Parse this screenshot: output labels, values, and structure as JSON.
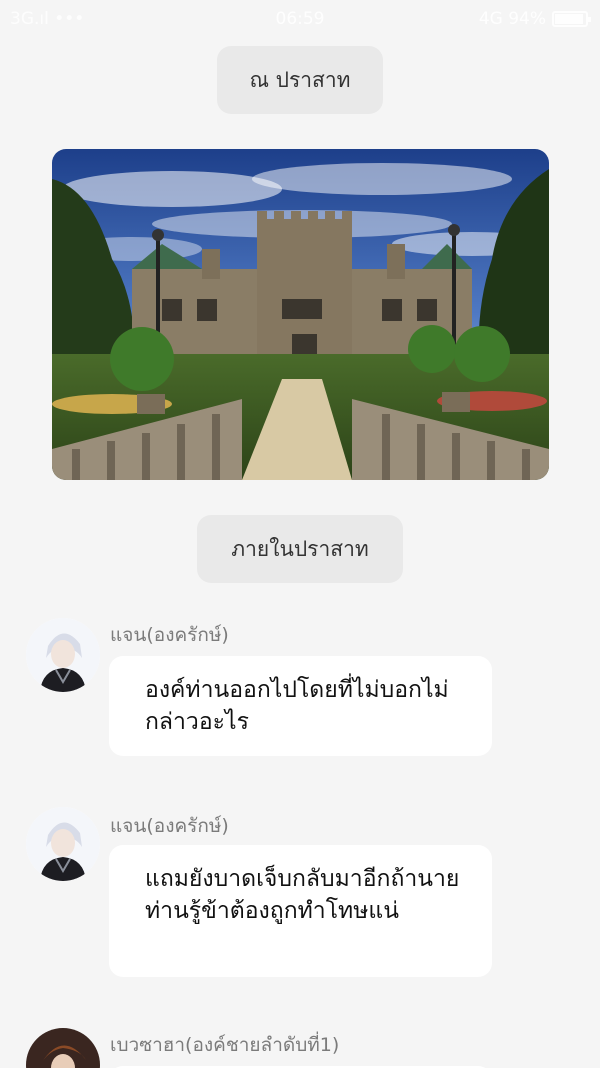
{
  "status_bar": {
    "left": "3G.ıl  •••",
    "time": "06:59",
    "right": "4G 94%",
    "battery_level": 0.94
  },
  "scenes": [
    {
      "label": "ณ ปราสาท"
    },
    {
      "label": "ภายในปราสาท"
    }
  ],
  "image": {
    "icon": "castle-photo"
  },
  "messages": [
    {
      "sender": "แจน(องครักษ์)",
      "text": "องค์ท่านออกไปโดยที่ไม่บอกไม่กล่าวอะไร"
    },
    {
      "sender": "แจน(องครักษ์)",
      "text": "แถมยังบาดเจ็บกลับมาอีกถ้านายท่านรู้ข้าต้องถูกทำโทษแน่"
    },
    {
      "sender": "เบวซาฮา(องค์ชายลำดับที่1)",
      "text": ""
    }
  ],
  "colors": {
    "background": "#f5f5f5",
    "chip": "#e9e9e9",
    "bubble": "#ffffff",
    "sender": "#7b7b7b"
  }
}
